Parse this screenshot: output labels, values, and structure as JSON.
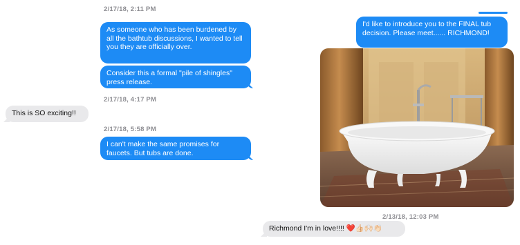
{
  "messages": {
    "ts1": "2/17/18, 2:11 PM",
    "m1": "As someone who has been burdened by all the bathtub discussions, I wanted to tell you they are officially over.",
    "m2": "Consider this a formal \"pile of shingles\" press release.",
    "ts2": "2/17/18, 4:17 PM",
    "m3": "This is SO exciting!!",
    "ts3": "2/17/18, 5:58 PM",
    "m4": "I can't make the same promises for faucets. But tubs are done.",
    "m5": "I'd like to introduce you to the FINAL tub decision. Please meet...... RICHMOND!",
    "ts4": "2/13/18, 12:03 PM",
    "m6": "Richmond I'm in love!!!! ❤️👍🏻🙌🏻👏🏻"
  },
  "image": {
    "subject": "white clawfoot bathtub with chrome faucet in marble hall",
    "colors": {
      "wall": "#c9a56d",
      "floor": "#6d4e3c",
      "tub": "#f4f4f4"
    }
  },
  "colors": {
    "blue_bubble": "#1d8bf5",
    "gray_bubble": "#e9e9eb",
    "timestamp": "#8e8e93"
  }
}
